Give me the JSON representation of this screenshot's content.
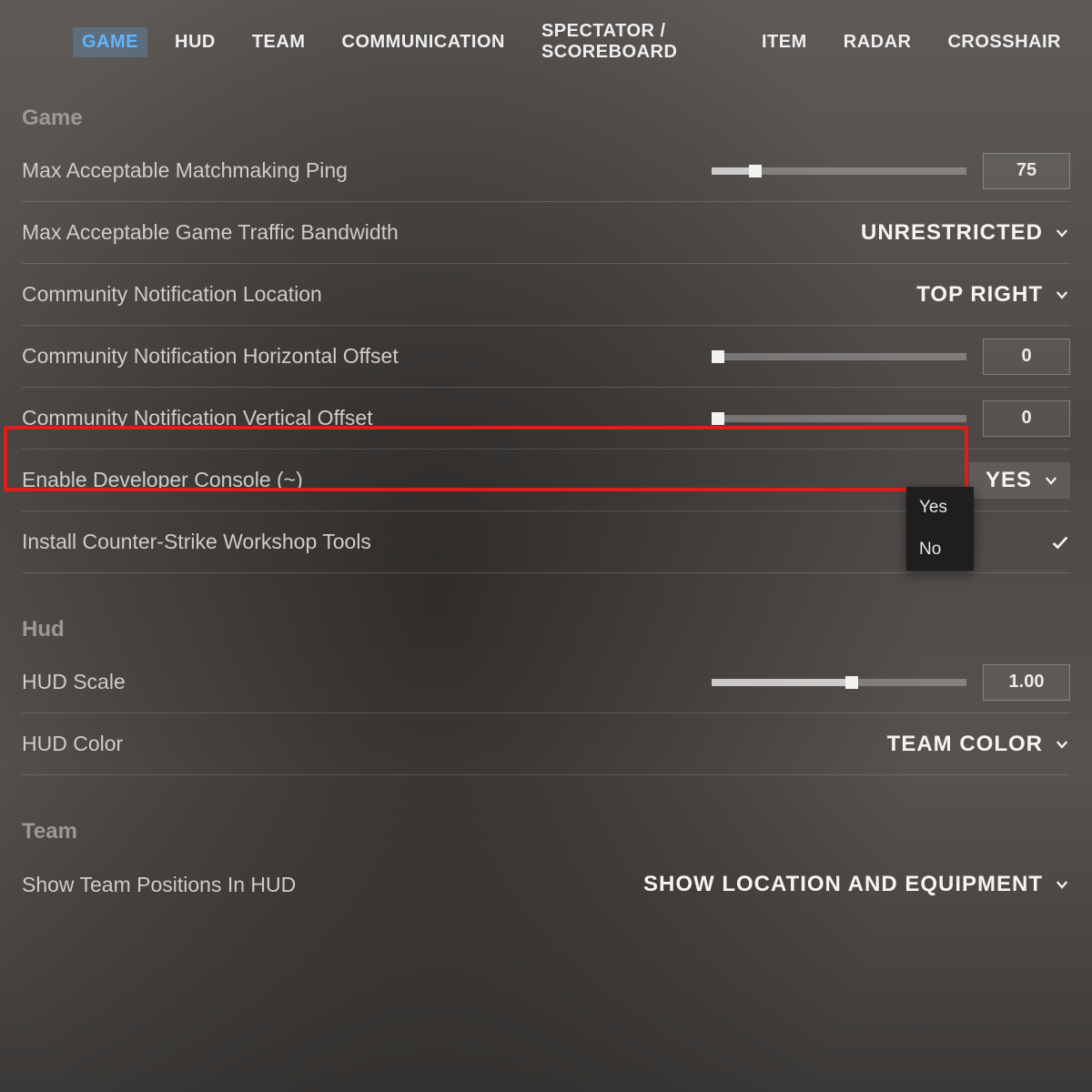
{
  "tabs": {
    "items": [
      "GAME",
      "HUD",
      "TEAM",
      "COMMUNICATION",
      "SPECTATOR / SCOREBOARD",
      "ITEM",
      "RADAR",
      "CROSSHAIR"
    ],
    "active_index": 0
  },
  "sections": {
    "game": {
      "title": "Game",
      "ping": {
        "label": "Max Acceptable Matchmaking Ping",
        "value": "75",
        "fraction": 0.17
      },
      "bandwidth": {
        "label": "Max Acceptable Game Traffic Bandwidth",
        "value": "UNRESTRICTED"
      },
      "notif_loc": {
        "label": "Community Notification Location",
        "value": "TOP RIGHT"
      },
      "notif_h": {
        "label": "Community Notification Horizontal Offset",
        "value": "0",
        "fraction": 0.0
      },
      "notif_v": {
        "label": "Community Notification Vertical Offset",
        "value": "0",
        "fraction": 0.0
      },
      "dev_console": {
        "label": "Enable Developer Console (~)",
        "value": "YES",
        "options": [
          "Yes",
          "No"
        ]
      },
      "workshop": {
        "label": "Install Counter-Strike Workshop Tools"
      }
    },
    "hud": {
      "title": "Hud",
      "scale": {
        "label": "HUD Scale",
        "value": "1.00",
        "fraction": 0.55
      },
      "color": {
        "label": "HUD Color",
        "value": "TEAM COLOR"
      }
    },
    "team": {
      "title": "Team",
      "positions": {
        "label": "Show Team Positions In HUD",
        "value": "SHOW LOCATION AND EQUIPMENT"
      }
    }
  }
}
